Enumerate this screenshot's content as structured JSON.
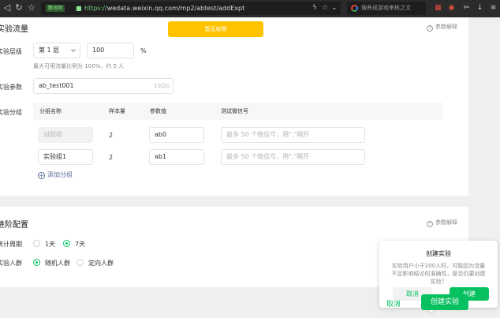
{
  "browser": {
    "secure_label": "腾讯网",
    "url_scheme": "https://",
    "url_rest": "wedata.weixin.qq.com/mp2/abtest/addExpt",
    "search_placeholder": "搜养成游戏审核之文"
  },
  "banner": {
    "text": "暂无权限"
  },
  "traffic": {
    "title": "实验流量",
    "help_label": "参数解释",
    "layer_label": "实验层级",
    "layer_value": "第 1 层",
    "percent_value": "100",
    "percent_unit": "%",
    "hint": "最大可用流量比例为 100%，约 5 人",
    "param_label": "实验参数",
    "param_value": "ab_test001",
    "param_counter": "10/20",
    "group_label": "实验分组",
    "columns": [
      "分组名称",
      "样本量",
      "参数值",
      "测试微信号"
    ],
    "rows": [
      {
        "name": "对照组",
        "sample": "2",
        "param": "ab0",
        "wechat_placeholder": "最多 50 个微信号，用\",\"隔开"
      },
      {
        "name": "实验组1",
        "sample": "2",
        "param": "ab1",
        "wechat_placeholder": "最多 50 个微信号，用\",\"隔开"
      }
    ],
    "add_group_label": "添加分组"
  },
  "advanced": {
    "title": "进阶配置",
    "help_label": "参数解释",
    "period_label": "统计周期",
    "period_options": [
      "1天",
      "7天"
    ],
    "period_selected": "7天",
    "audience_label": "实验人群",
    "audience_options": [
      "随机人群",
      "定向人群"
    ],
    "audience_selected": "随机人群"
  },
  "footer": {
    "cancel_label": "取消",
    "create_label": "创建实验"
  },
  "popover": {
    "title": "创建实验",
    "body": "实验用户小于200人时，可能因为流量不足影响结论的准确性，是否仍要创建实验？",
    "cancel_label": "取消",
    "confirm_label": "创建"
  },
  "colors": {
    "accent": "#07c160",
    "banner": "#ffc300",
    "link": "#576b95"
  }
}
